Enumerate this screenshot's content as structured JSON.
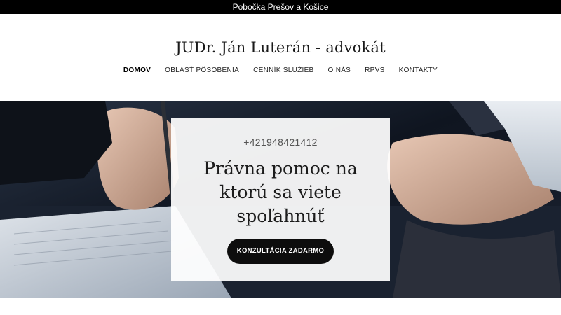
{
  "topbar": {
    "text": "Pobočka Prešov a Košice"
  },
  "header": {
    "site_title": "JUDr. Ján Luterán - advokát",
    "nav": [
      {
        "label": "DOMOV",
        "active": true
      },
      {
        "label": "OBLASŤ PÔSOBENIA",
        "active": false
      },
      {
        "label": "CENNÍK SLUŽIEB",
        "active": false
      },
      {
        "label": "O NÁS",
        "active": false
      },
      {
        "label": "RPVS",
        "active": false
      },
      {
        "label": "KONTAKTY",
        "active": false
      }
    ]
  },
  "hero": {
    "phone": "+421948421412",
    "headline": "Právna pomoc na ktorú sa viete spoľahnúť",
    "cta_label": "KONZULTÁCIA ZADARMO"
  },
  "colors": {
    "topbar_bg": "#000000",
    "cta_bg": "#0d0d0d",
    "hero_dark": "#0f1520"
  }
}
